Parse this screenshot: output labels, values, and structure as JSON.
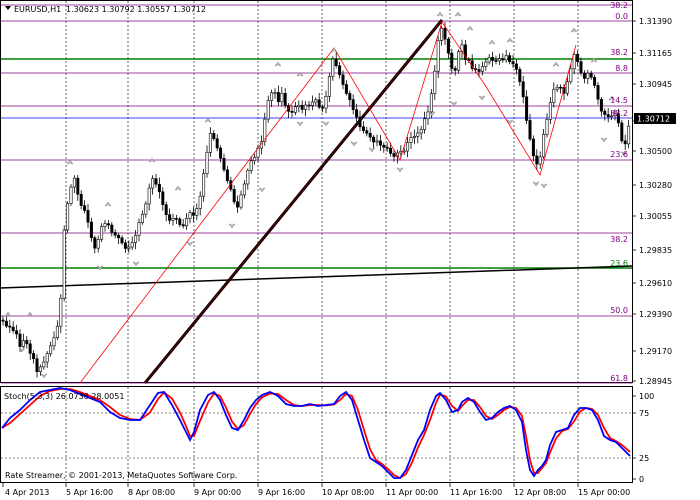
{
  "header": {
    "symbol": "EURUSD,H1",
    "prices": "1.30623 1.30792 1.30557 1.30712"
  },
  "price_axis": {
    "ticks": [
      "1.31390",
      "1.31165",
      "1.30945",
      "1.30712",
      "1.30500",
      "1.30280",
      "1.30055",
      "1.29835",
      "1.29610",
      "1.29390",
      "1.29170",
      "1.28945"
    ],
    "current": "1.30712"
  },
  "time_axis": {
    "ticks": [
      "4 Apr 2013",
      "5 Apr 16:00",
      "8 Apr 08:00",
      "9 Apr 00:00",
      "9 Apr 16:00",
      "10 Apr 08:00",
      "11 Apr 00:00",
      "11 Apr 16:00",
      "12 Apr 08:00",
      "15 Apr 00:00"
    ]
  },
  "fibo_upper": [
    "38.2",
    "0.0",
    "38.2",
    "8.8",
    "14.5",
    "38.2",
    "23.6"
  ],
  "fibo_lower": [
    "38.2",
    "23.6",
    "50.0",
    "61.8"
  ],
  "stochastic": {
    "label": "Stoch(5,3,3) 26.0738 28.0051",
    "scale": [
      "100",
      "75",
      "25",
      "0"
    ]
  },
  "footer": {
    "copyright": "Rate Streamer, © 2001-2013, MetaQuotes Software Corp."
  },
  "colors": {
    "up_candle": "#ffffff",
    "down_candle": "#000000",
    "fibo_line": "#800080",
    "green_line": "#008000",
    "trend_thick": "#000000",
    "trend_red": "#ff0000",
    "current_price_line": "#0000ff",
    "stoch_main": "#0000ff",
    "stoch_signal": "#ff0000",
    "current_price_bg": "#000000"
  }
}
